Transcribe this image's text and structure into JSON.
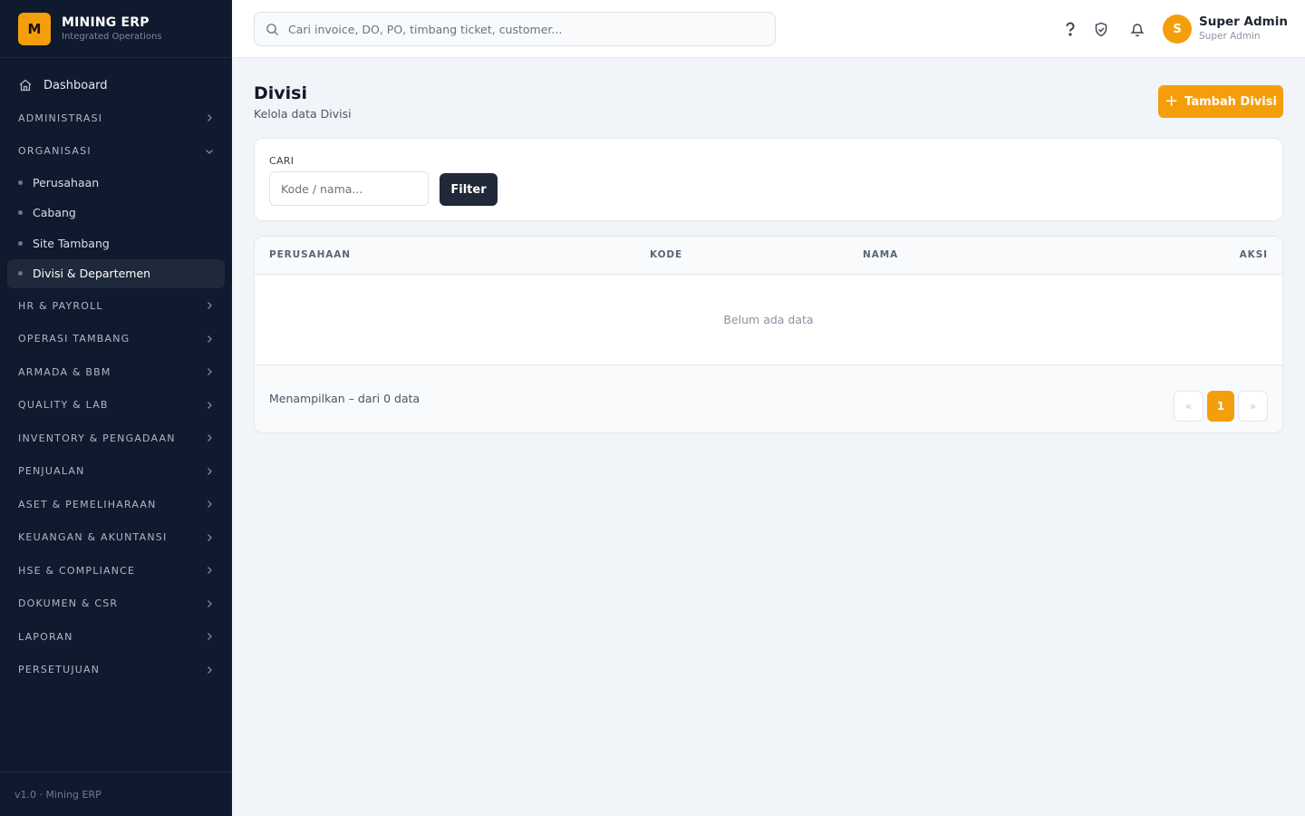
{
  "brand": {
    "logo_letter": "M",
    "name": "MINING ERP",
    "subtitle": "Integrated Operations"
  },
  "sidebar": {
    "dashboard": "Dashboard",
    "sections": [
      {
        "label": "ADMINISTRASI",
        "expanded": false
      },
      {
        "label": "ORGANISASI",
        "expanded": true,
        "items": [
          {
            "label": "Perusahaan",
            "active": false
          },
          {
            "label": "Cabang",
            "active": false
          },
          {
            "label": "Site Tambang",
            "active": false
          },
          {
            "label": "Divisi & Departemen",
            "active": true
          }
        ]
      },
      {
        "label": "HR & PAYROLL",
        "expanded": false
      },
      {
        "label": "OPERASI TAMBANG",
        "expanded": false
      },
      {
        "label": "ARMADA & BBM",
        "expanded": false
      },
      {
        "label": "QUALITY & LAB",
        "expanded": false
      },
      {
        "label": "INVENTORY & PENGADAAN",
        "expanded": false
      },
      {
        "label": "PENJUALAN",
        "expanded": false
      },
      {
        "label": "ASET & PEMELIHARAAN",
        "expanded": false
      },
      {
        "label": "KEUANGAN & AKUNTANSI",
        "expanded": false
      },
      {
        "label": "HSE & COMPLIANCE",
        "expanded": false
      },
      {
        "label": "DOKUMEN & CSR",
        "expanded": false
      },
      {
        "label": "LAPORAN",
        "expanded": false
      },
      {
        "label": "PERSETUJUAN",
        "expanded": false
      }
    ],
    "footer": "v1.0 · Mining ERP"
  },
  "header": {
    "search_placeholder": "Cari invoice, DO, PO, timbang ticket, customer...",
    "user": {
      "initial": "S",
      "name": "Super Admin",
      "role": "Super Admin"
    }
  },
  "page": {
    "title": "Divisi",
    "subtitle": "Kelola data Divisi",
    "add_button": "Tambah Divisi"
  },
  "filter": {
    "label": "CARI",
    "placeholder": "Kode / nama...",
    "button": "Filter"
  },
  "table": {
    "columns": [
      "PERUSAHAAN",
      "KODE",
      "NAMA",
      "AKSI"
    ],
    "rows": [],
    "empty_text": "Belum ada data"
  },
  "pagination": {
    "summary": "Menampilkan – dari 0 data",
    "prev": "«",
    "current": "1",
    "next": "»"
  },
  "colors": {
    "accent": "#f59e0b",
    "sidebar_bg": "#0f1a2e",
    "page_bg": "#f1f4f8",
    "dark_button": "#1f2937"
  }
}
